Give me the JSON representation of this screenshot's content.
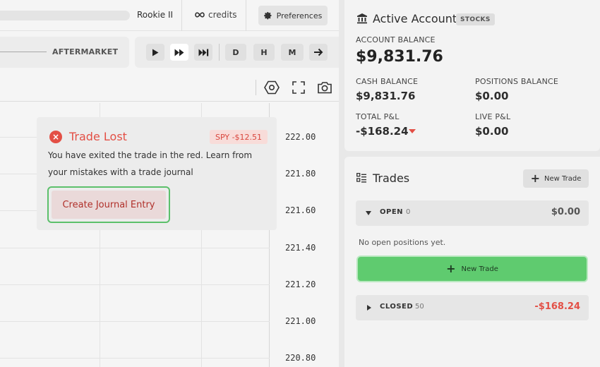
{
  "topbar": {
    "rank": "Rookie II",
    "credits_label": "credits",
    "preferences_label": "Preferences"
  },
  "session": {
    "label": "AFTERMARKET"
  },
  "controls": {
    "timeframes": [
      "D",
      "H",
      "M"
    ]
  },
  "chart": {
    "price_labels": [
      "222.00",
      "221.80",
      "221.60",
      "221.40",
      "221.20",
      "221.00",
      "220.80"
    ]
  },
  "toast": {
    "title": "Trade Lost",
    "badge": "SPY -$12.51",
    "message": "You have exited the trade in the red. Learn from your mistakes with a trade journal",
    "button_label": "Create Journal Entry"
  },
  "account": {
    "title": "Active Account",
    "badge": "STOCKS",
    "account_balance_label": "ACCOUNT BALANCE",
    "account_balance": "$9,831.76",
    "cash_balance_label": "CASH BALANCE",
    "cash_balance": "$9,831.76",
    "positions_balance_label": "POSITIONS BALANCE",
    "positions_balance": "$0.00",
    "total_pnl_label": "TOTAL P&L",
    "total_pnl": "-$168.24",
    "live_pnl_label": "LIVE P&L",
    "live_pnl": "$0.00"
  },
  "trades": {
    "title": "Trades",
    "new_trade_label": "New Trade",
    "open": {
      "label": "OPEN",
      "count": "0",
      "amount": "$0.00"
    },
    "empty_message": "No open positions yet.",
    "new_trade_big_label": "New Trade",
    "closed": {
      "label": "CLOSED",
      "count": "50",
      "amount": "-$168.24"
    }
  },
  "colors": {
    "loss": "#e34f45",
    "accent_green": "#5fcb6f"
  }
}
